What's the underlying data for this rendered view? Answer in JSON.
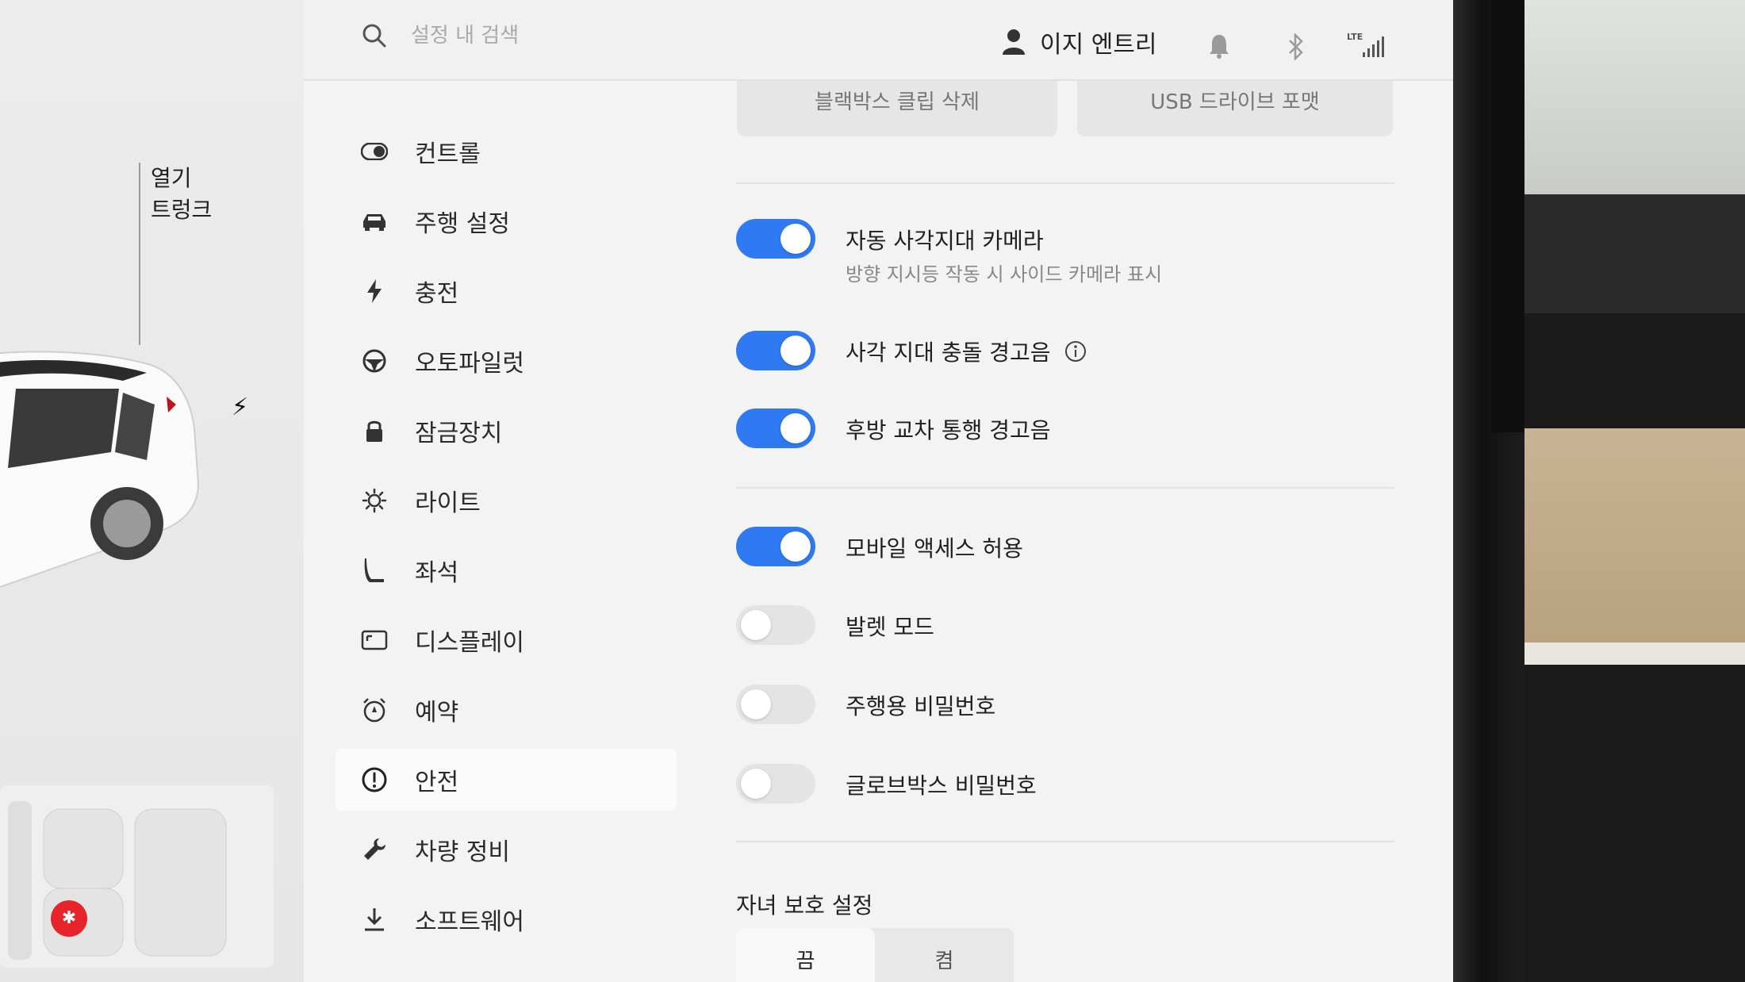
{
  "car_panel": {
    "trunk_line1": "열기",
    "trunk_line2": "트렁크"
  },
  "search": {
    "placeholder": "설정 내 검색",
    "value": ""
  },
  "profile": {
    "name": "이지 엔트리"
  },
  "status": {
    "network_label": "LTE"
  },
  "sidebar": {
    "items": [
      {
        "label": "컨트롤",
        "icon": "toggle-icon"
      },
      {
        "label": "주행 설정",
        "icon": "car-icon"
      },
      {
        "label": "충전",
        "icon": "bolt-icon"
      },
      {
        "label": "오토파일럿",
        "icon": "steering-wheel-icon"
      },
      {
        "label": "잠금장치",
        "icon": "lock-icon"
      },
      {
        "label": "라이트",
        "icon": "sun-icon"
      },
      {
        "label": "좌석",
        "icon": "seat-icon"
      },
      {
        "label": "디스플레이",
        "icon": "display-icon"
      },
      {
        "label": "예약",
        "icon": "alarm-icon"
      },
      {
        "label": "안전",
        "icon": "alert-circle-icon",
        "active": true
      },
      {
        "label": "차량 정비",
        "icon": "wrench-icon"
      },
      {
        "label": "소프트웨어",
        "icon": "download-icon"
      }
    ]
  },
  "top_buttons": {
    "left": "블랙박스 클립 삭제",
    "right": "USB 드라이브 포맷"
  },
  "settings": {
    "blind_spot_camera": {
      "label": "자동 사각지대 카메라",
      "sub": "방향 지시등 작동 시 사이드 카메라 표시",
      "on": true
    },
    "blind_spot_chime": {
      "label": "사각 지대 충돌 경고음",
      "on": true
    },
    "rear_cross_traffic": {
      "label": "후방 교차 통행 경고음",
      "on": true
    },
    "mobile_access": {
      "label": "모바일 액세스 허용",
      "on": true
    },
    "valet_mode": {
      "label": "발렛 모드",
      "on": false
    },
    "pin_to_drive": {
      "label": "주행용 비밀번호",
      "on": false
    },
    "glovebox_pin": {
      "label": "글로브박스 비밀번호",
      "on": false
    }
  },
  "child_lock": {
    "title": "자녀 보호 설정",
    "options": [
      "끔",
      "켬"
    ],
    "selected": "끔"
  },
  "colors": {
    "accent": "#2f7af2",
    "alert": "#e8242b"
  }
}
